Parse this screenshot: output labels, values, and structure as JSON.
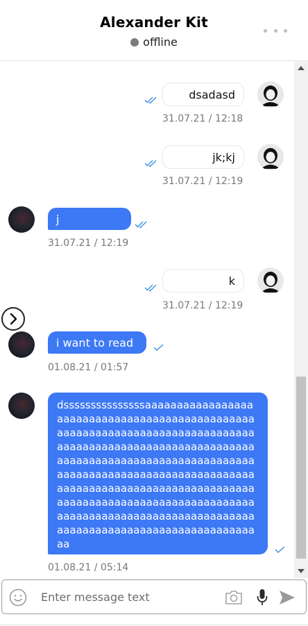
{
  "header": {
    "contact_name": "Alexander Kit",
    "status": "offline",
    "more_icon": "more-dots-icon"
  },
  "messages": [
    {
      "direction": "outgoing",
      "text": "dsadasd",
      "timestamp": "31.07.21 / 12:18",
      "read": true
    },
    {
      "direction": "outgoing",
      "text": "jk;kj",
      "timestamp": "31.07.21 / 12:19",
      "read": true
    },
    {
      "direction": "incoming",
      "text": "j",
      "timestamp": "31.07.21 / 12:19",
      "read": true
    },
    {
      "direction": "outgoing",
      "text": "k",
      "timestamp": "31.07.21 / 12:19",
      "read": true
    },
    {
      "direction": "incoming",
      "text": "i want to read",
      "timestamp": "01.08.21 / 01:57",
      "read": false
    },
    {
      "direction": "incoming",
      "text": "dsssssssssssssssaaaaaaaaaaaaaaaaaaaaaaaaaaaaaaaaaaaaaaaaaaaaaaaaaaaaaaaaaaaaaaaaaaaaaaaaaaaaaaaaaaaaaaaaaaaaaaaaaaaaaaaaaaaaaaaaaaaaaaaaaaaaaaaaaaaaaaaaaaaaaaaaaaaaaaaaaaaaaaaaaaaaaaaaaaaaaaaaaaaaaaaaaaaaaaaaaaaaaaaaaaaaaaaaaaaaaaaaaaaaaaaaaaaaaaaaaaaaaaaaaaaaaaaaaaaaaaaaaaaaaaaaaaaaaaaaaaaaaaaaaaaaaaaaaaaaaaaaaa",
      "timestamp": "01.08.21 / 05:14",
      "read": false
    }
  ],
  "composer": {
    "placeholder": "Enter message text",
    "emoji_icon": "emoji-icon",
    "camera_icon": "camera-icon",
    "mic_icon": "microphone-icon",
    "send_icon": "send-icon"
  },
  "colors": {
    "incoming_bubble": "#3d78f5",
    "read_check": "#3a8ee6",
    "status_dot": "#7c7c7c"
  }
}
